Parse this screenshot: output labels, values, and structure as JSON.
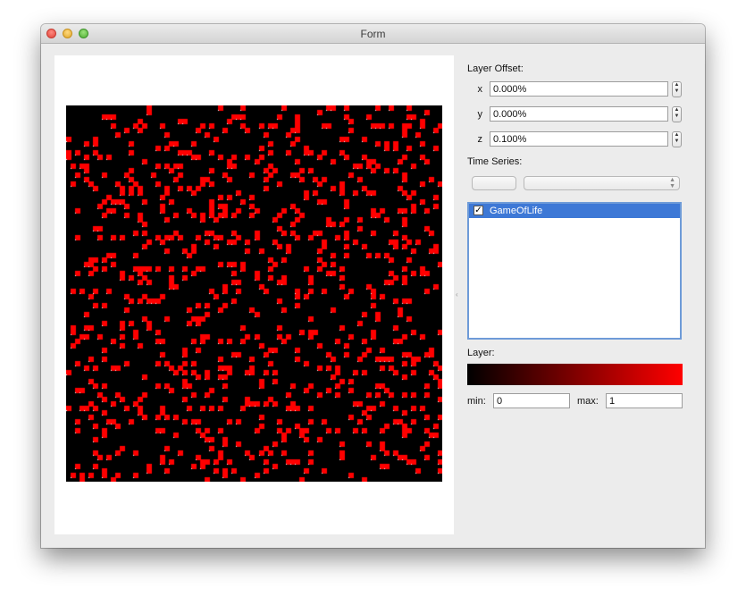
{
  "window": {
    "title": "Form"
  },
  "layer_offset": {
    "label": "Layer Offset:",
    "x": {
      "label": "x",
      "value": "0.000%"
    },
    "y": {
      "label": "y",
      "value": "0.000%"
    },
    "z": {
      "label": "z",
      "value": "0.100%"
    }
  },
  "time_series": {
    "label": "Time Series:",
    "button_label": "",
    "combo_value": ""
  },
  "layers_list": {
    "items": [
      {
        "label": "GameOfLife",
        "checked": true,
        "selected": true
      }
    ]
  },
  "layer": {
    "label": "Layer:",
    "colormap": {
      "from": "#000000",
      "to": "#ff0000"
    },
    "min": {
      "label": "min:",
      "value": "0"
    },
    "max": {
      "label": "max:",
      "value": "1"
    }
  },
  "game_of_life": {
    "grid_size": 84,
    "background": "#000000",
    "live_color": "#ff0000",
    "approx_live_fraction": 0.13
  }
}
